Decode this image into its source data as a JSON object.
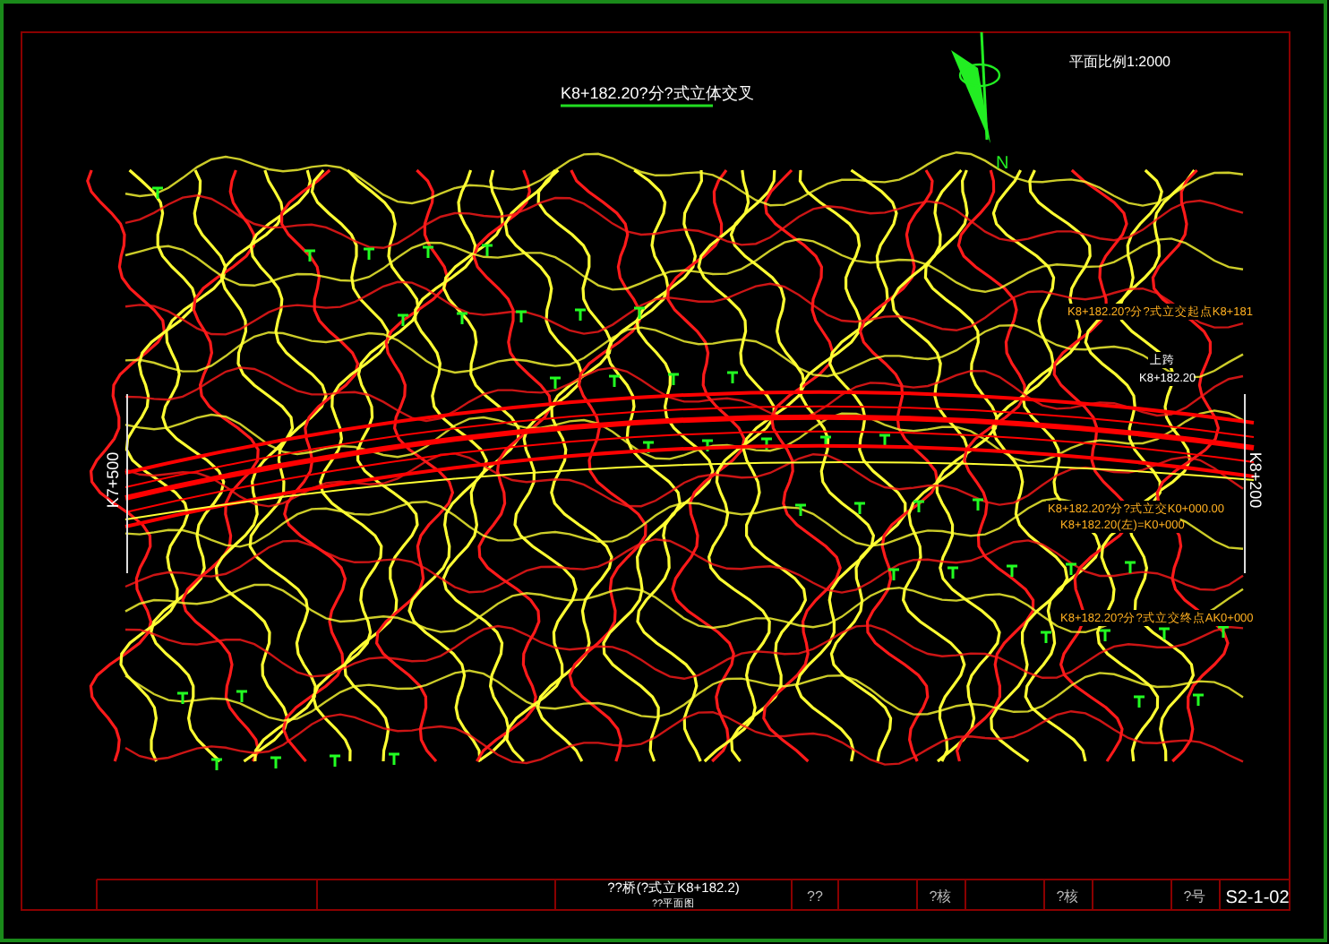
{
  "drawing_title": "K8+182.20?分?式立体交叉",
  "scale_note": "平面比例1:2000",
  "north_label": "N",
  "stations": [
    {
      "text": "K7+500"
    },
    {
      "text": "K8+200"
    }
  ],
  "annotations": [
    {
      "text": "K8+182.20?分?式立交起点K8+181",
      "kind": "orange"
    },
    {
      "text": "上跨",
      "kind": "white"
    },
    {
      "text": "K8+182.20",
      "kind": "white"
    },
    {
      "text": "K8+182.20?分?式立交K0+000.00",
      "kind": "orange"
    },
    {
      "text": "K8+182.20(左)=K0+000",
      "kind": "orange"
    },
    {
      "text": "K8+182.20?分?式立交终点AK0+000",
      "kind": "orange"
    }
  ],
  "title_block": {
    "title_line_1": "??桥(?式立K8+182.2)",
    "title_line_2": "??平面图",
    "cells": [
      "??",
      "?核",
      "?核",
      "?号"
    ],
    "sheet_number": "S2-1-02"
  }
}
